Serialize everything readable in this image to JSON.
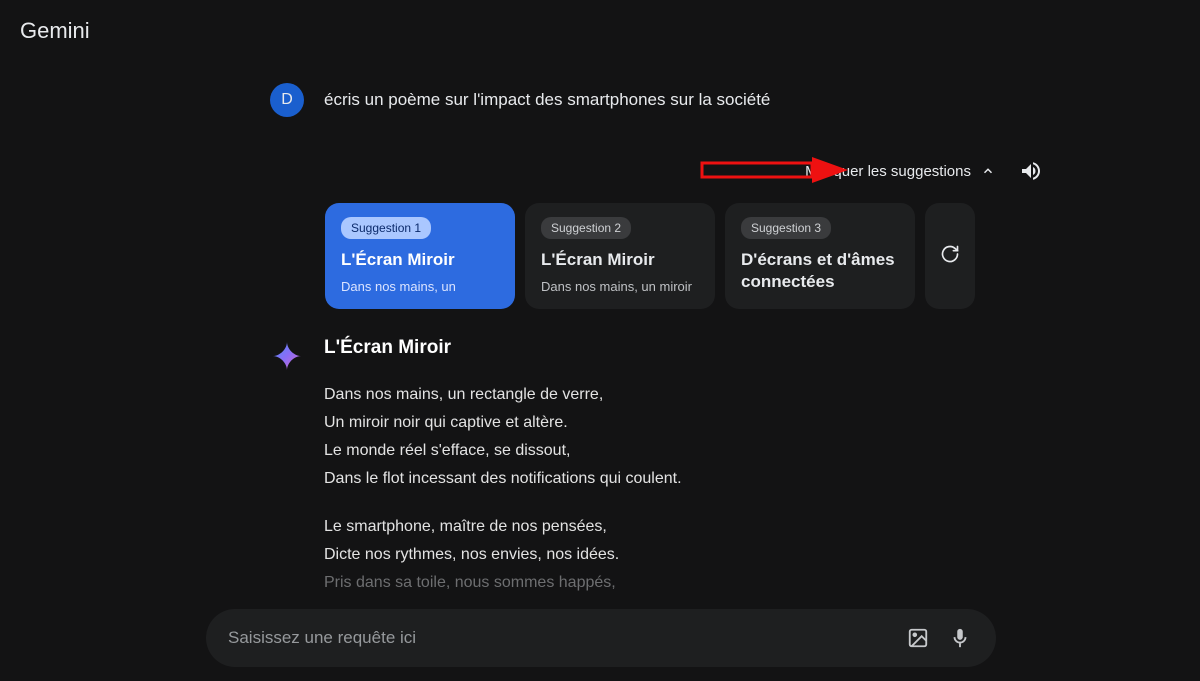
{
  "app": {
    "title": "Gemini"
  },
  "user": {
    "initial": "D",
    "prompt": "écris un poème sur l'impact des smartphones sur la société"
  },
  "controls": {
    "hide_suggestions": "Masquer les suggestions"
  },
  "suggestions": [
    {
      "badge": "Suggestion 1",
      "title": "L'Écran Miroir",
      "snippet": "Dans nos mains, un"
    },
    {
      "badge": "Suggestion 2",
      "title": "L'Écran Miroir",
      "snippet": "Dans nos mains, un miroir"
    },
    {
      "badge": "Suggestion 3",
      "title": "D'écrans et d'âmes connectées",
      "snippet": ""
    }
  ],
  "response": {
    "title": "L'Écran Miroir",
    "stanza1": {
      "l1": "Dans nos mains, un rectangle de verre,",
      "l2": "Un miroir noir qui captive et altère.",
      "l3": "Le monde réel s'efface, se dissout,",
      "l4": "Dans le flot incessant des notifications qui coulent."
    },
    "stanza2": {
      "l1": "Le smartphone, maître de nos pensées,",
      "l2": "Dicte nos rythmes, nos envies, nos idées.",
      "l3": "Pris dans sa toile, nous sommes happés,"
    }
  },
  "input": {
    "placeholder": "Saisissez une requête ici"
  }
}
